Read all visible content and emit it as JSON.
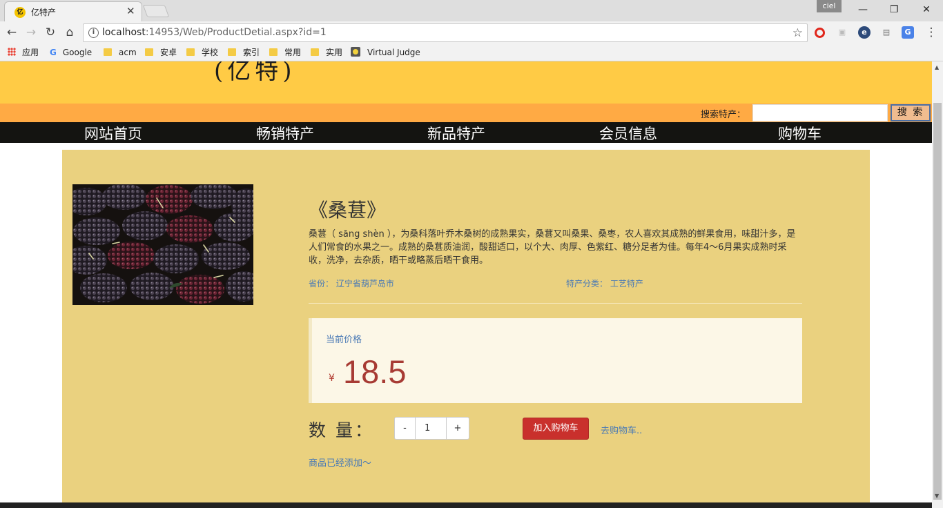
{
  "browser": {
    "tab_title": "亿特产",
    "tab_favicon": "亿",
    "profile_name": "ciel",
    "url_host": "localhost",
    "url_rest": ":14953/Web/ProductDetial.aspx?id=1",
    "bookmarks": [
      {
        "label": "应用",
        "icon": "apps-icon"
      },
      {
        "label": "Google",
        "icon": "google-icon"
      },
      {
        "label": "acm",
        "icon": "folder-icon"
      },
      {
        "label": "安卓",
        "icon": "folder-icon"
      },
      {
        "label": "学校",
        "icon": "folder-icon"
      },
      {
        "label": "索引",
        "icon": "folder-icon"
      },
      {
        "label": "常用",
        "icon": "folder-icon"
      },
      {
        "label": "实用",
        "icon": "folder-icon"
      },
      {
        "label": "Virtual Judge",
        "icon": "virtual-judge-icon"
      }
    ]
  },
  "header": {
    "logo_fragment": "(亿特)",
    "search_label": "搜索特产：",
    "search_value": "",
    "search_button": "搜 索"
  },
  "menu": {
    "items": [
      "网站首页",
      "畅销特产",
      "新品特产",
      "会员信息",
      "购物车"
    ]
  },
  "product": {
    "title": "《桑葚》",
    "description": "桑葚（ sāng shèn ），为桑科落叶乔木桑树的成熟果实，桑葚又叫桑果、桑枣，农人喜欢其成熟的鲜果食用，味甜汁多，是人们常食的水果之一。成熟的桑葚质油润，酸甜适口，以个大、肉厚、色紫红、糖分足者为佳。每年4～6月果实成熟时采收，洗净，去杂质，晒干或略蒸后晒干食用。",
    "province_label": "省份：",
    "province_value": "辽宁省葫芦岛市",
    "category_label": "特产分类：",
    "category_value": "工艺特产",
    "price_label": "当前价格",
    "currency": "¥",
    "price": "18.5",
    "quantity_label": "数 量：",
    "quantity_minus": "-",
    "quantity_value": "1",
    "quantity_plus": "+",
    "add_to_cart": "加入购物车",
    "go_to_cart": "去购物车..",
    "added_message": "商品已经添加～"
  },
  "colors": {
    "header_yellow": "#ffcb45",
    "search_band_orange": "#ffaa44",
    "menu_bg": "#141411",
    "panel_bg": "#ead17f",
    "price_red": "#a73b34",
    "link_blue": "#4a7ab5",
    "cart_button": "#c9302c"
  }
}
